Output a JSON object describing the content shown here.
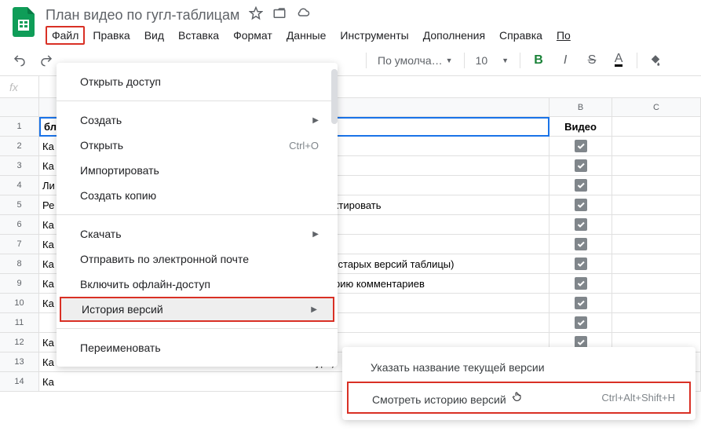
{
  "doc_title": "План видео по гугл-таблицам",
  "menubar": [
    "Файл",
    "Правка",
    "Вид",
    "Вставка",
    "Формат",
    "Данные",
    "Инструменты",
    "Дополнения",
    "Справка",
    "По"
  ],
  "toolbar": {
    "font_label": "По умолча…",
    "font_size": "10"
  },
  "col_headers": [
    "B",
    "C"
  ],
  "rows": [
    {
      "a": "блицам",
      "b_checked": false,
      "b_text": "Видео",
      "bold": true,
      "selected": true
    },
    {
      "a": "Ка",
      "b_checked": true
    },
    {
      "a": "Ка",
      "b_checked": true
    },
    {
      "a": "Ли",
      "b_checked": true
    },
    {
      "a": "Ре",
      "a_suffix": ", редактировать",
      "b_checked": true
    },
    {
      "a": "Ка",
      "b_checked": true
    },
    {
      "a": "Ка",
      "b_checked": true
    },
    {
      "a": "Ка",
      "a_suffix": "дну из старых версий таблицы)",
      "b_checked": true
    },
    {
      "a": "Ка",
      "a_suffix": "ь историю комментариев",
      "b_checked": true
    },
    {
      "a": "Ка",
      "b_checked": true
    },
    {
      "a": "",
      "b_checked": true
    },
    {
      "a": "Ка",
      "b_checked": true
    },
    {
      "a": "Ка",
      "a_suffix": "атуро)",
      "b_checked": true
    },
    {
      "a": "Ка",
      "b_checked": true
    }
  ],
  "file_menu": [
    {
      "label": "Открыть доступ",
      "type": "item"
    },
    {
      "type": "sep"
    },
    {
      "label": "Создать",
      "type": "submenu"
    },
    {
      "label": "Открыть",
      "shortcut": "Ctrl+O",
      "type": "item"
    },
    {
      "label": "Импортировать",
      "type": "item"
    },
    {
      "label": "Создать копию",
      "type": "item"
    },
    {
      "type": "sep"
    },
    {
      "label": "Скачать",
      "type": "submenu"
    },
    {
      "label": "Отправить по электронной почте",
      "type": "item"
    },
    {
      "label": "Включить офлайн-доступ",
      "type": "item"
    },
    {
      "label": "История версий",
      "type": "submenu",
      "highlighted": true
    },
    {
      "type": "sep"
    },
    {
      "label": "Переименовать",
      "type": "item"
    }
  ],
  "version_submenu": [
    {
      "label": "Указать название текущей версии"
    },
    {
      "label": "Смотреть историю версий",
      "shortcut": "Ctrl+Alt+Shift+H",
      "highlighted": true,
      "cursor": true
    }
  ],
  "fx": "fx"
}
